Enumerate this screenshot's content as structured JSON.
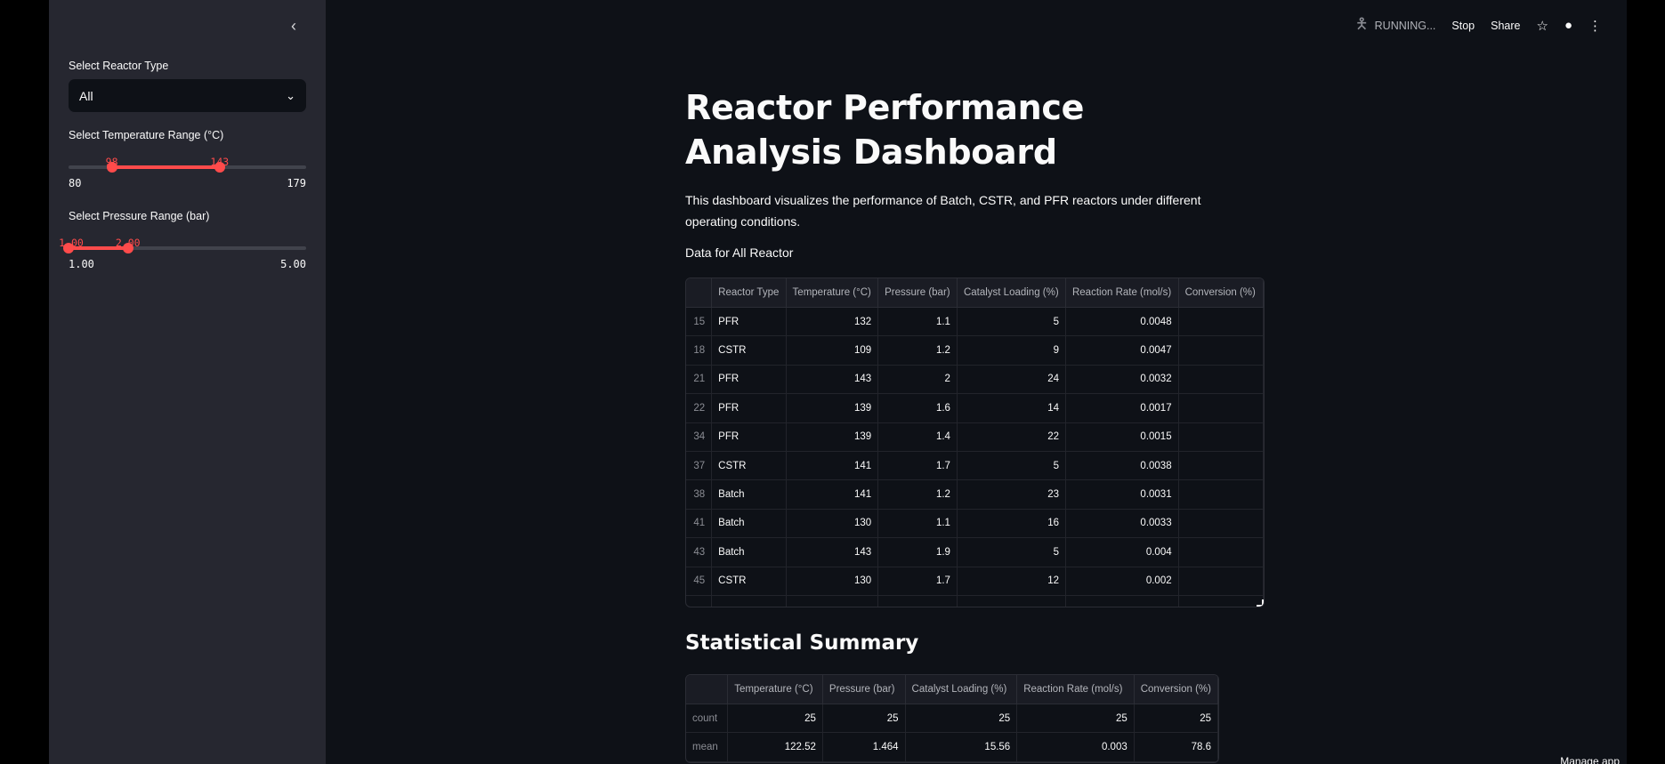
{
  "sidebar": {
    "collapse_icon": "chevron-left-icon",
    "reactor_type_label": "Select Reactor Type",
    "reactor_type_value": "All",
    "temperature_label": "Select Temperature Range (°C)",
    "temperature": {
      "min": "80",
      "max": "179",
      "low": "98",
      "high": "143",
      "low_frac": 0.182,
      "high_frac": 0.636
    },
    "pressure_label": "Select Pressure Range (bar)",
    "pressure": {
      "min": "1.00",
      "max": "5.00",
      "low": "1.00",
      "high": "2.00",
      "low_frac": 0.0,
      "high_frac": 0.25
    }
  },
  "toolbar": {
    "running": "RUNNING...",
    "stop": "Stop",
    "share": "Share",
    "icons": [
      "running-man-icon",
      "star-icon",
      "github-icon",
      "more-vertical-icon"
    ]
  },
  "main": {
    "title": "Reactor Performance Analysis Dashboard",
    "description": "This dashboard visualizes the performance of Batch, CSTR, and PFR reactors under different operating conditions.",
    "data_label": "Data for All Reactor",
    "table": {
      "columns": [
        "",
        "Reactor Type",
        "Temperature (°C)",
        "Pressure (bar)",
        "Catalyst Loading (%)",
        "Reaction Rate (mol/s)",
        "Conversion (%)"
      ],
      "rows": [
        [
          "15",
          "PFR",
          "132",
          "1.1",
          "5",
          "0.0048",
          ""
        ],
        [
          "18",
          "CSTR",
          "109",
          "1.2",
          "9",
          "0.0047",
          ""
        ],
        [
          "21",
          "PFR",
          "143",
          "2",
          "24",
          "0.0032",
          ""
        ],
        [
          "22",
          "PFR",
          "139",
          "1.6",
          "14",
          "0.0017",
          ""
        ],
        [
          "34",
          "PFR",
          "139",
          "1.4",
          "22",
          "0.0015",
          ""
        ],
        [
          "37",
          "CSTR",
          "141",
          "1.7",
          "5",
          "0.0038",
          ""
        ],
        [
          "38",
          "Batch",
          "141",
          "1.2",
          "23",
          "0.0031",
          ""
        ],
        [
          "41",
          "Batch",
          "130",
          "1.1",
          "16",
          "0.0033",
          ""
        ],
        [
          "43",
          "Batch",
          "143",
          "1.9",
          "5",
          "0.004",
          ""
        ],
        [
          "45",
          "CSTR",
          "130",
          "1.7",
          "12",
          "0.002",
          ""
        ]
      ]
    },
    "summary_title": "Statistical Summary",
    "summary": {
      "columns": [
        "",
        "Temperature (°C)",
        "Pressure (bar)",
        "Catalyst Loading (%)",
        "Reaction Rate (mol/s)",
        "Conversion (%)"
      ],
      "rows": [
        [
          "count",
          "25",
          "25",
          "25",
          "25",
          "25"
        ],
        [
          "mean",
          "122.52",
          "1.464",
          "15.56",
          "0.003",
          "78.6"
        ]
      ]
    },
    "bottom_badge": "Manage app"
  },
  "colors": {
    "accent": "#ff4b4b",
    "background": "#0e1117",
    "sidebar": "#262730"
  }
}
